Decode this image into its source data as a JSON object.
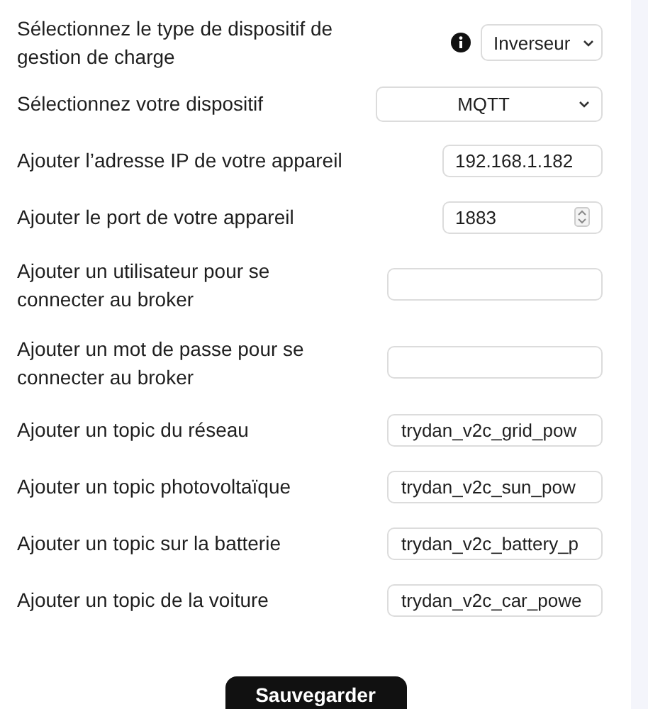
{
  "rows": [
    {
      "label": "Sélectionnez le type de dispositif de gestion de charge",
      "kind": "select",
      "info": true,
      "value": "Inverseur"
    },
    {
      "label": "Sélectionnez votre dispositif",
      "kind": "select",
      "info": false,
      "value": "MQTT"
    },
    {
      "label": "Ajouter l’adresse IP de votre appareil",
      "kind": "short-text",
      "value": "192.168.1.182"
    },
    {
      "label": "Ajouter le port de votre appareil",
      "kind": "number",
      "value": "1883"
    },
    {
      "label": "Ajouter un utilisateur pour se connecter au broker",
      "kind": "text"
    },
    {
      "label": "Ajouter un mot de passe pour se connecter au broker",
      "kind": "text"
    },
    {
      "label": "Ajouter un topic du réseau",
      "kind": "text",
      "value": "trydan_v2c_grid_pow"
    },
    {
      "label": "Ajouter un topic photovoltaïque",
      "kind": "text",
      "value": "trydan_v2c_sun_pow"
    },
    {
      "label": "Ajouter un topic sur la batterie",
      "kind": "text",
      "value": "trydan_v2c_battery_p"
    },
    {
      "label": "Ajouter un topic de la voiture",
      "kind": "text",
      "value": "trydan_v2c_car_powe"
    }
  ],
  "save_button": "Sauvegarder"
}
